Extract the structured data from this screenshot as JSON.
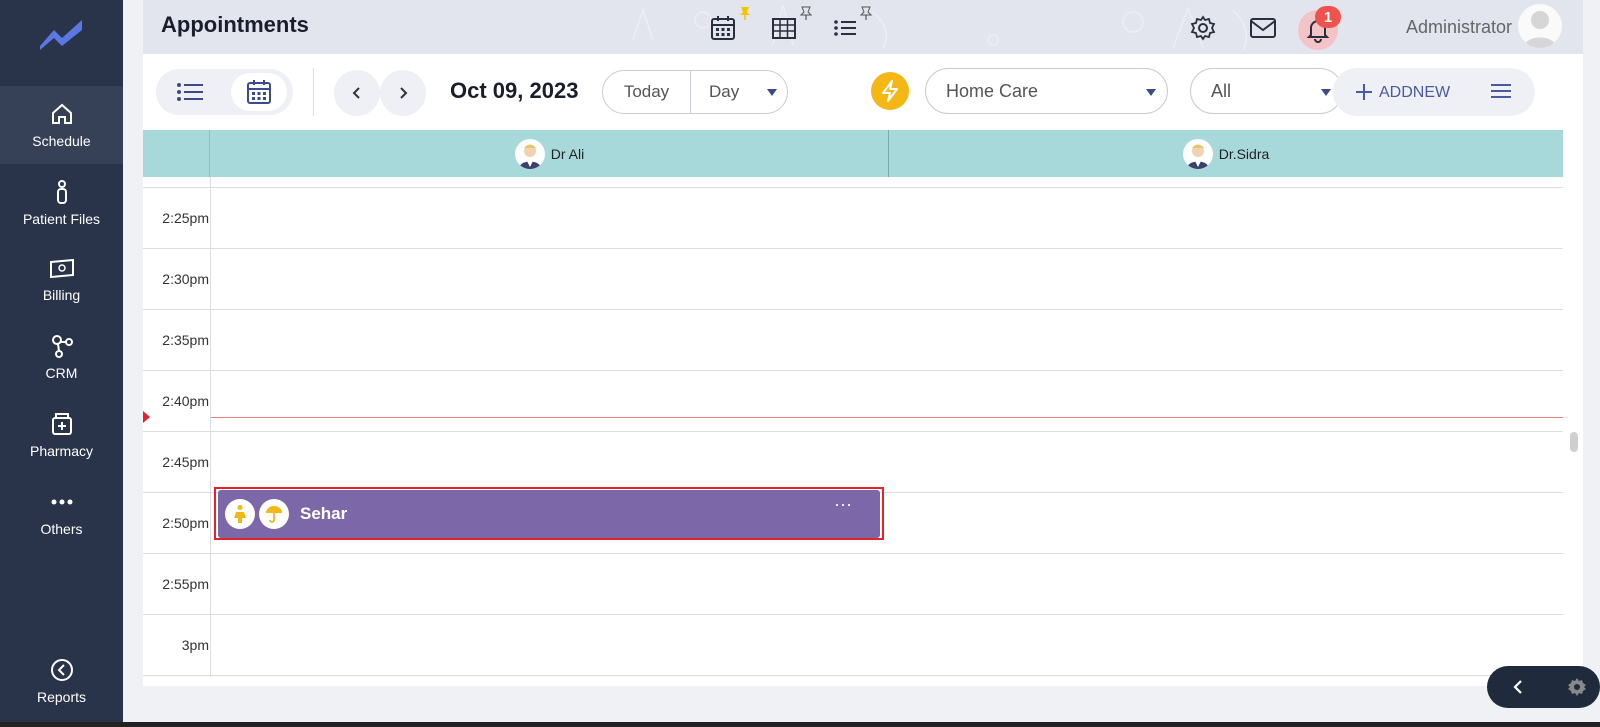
{
  "sidebar": {
    "items": [
      {
        "label": "Schedule",
        "icon": "home-icon"
      },
      {
        "label": "Patient Files",
        "icon": "person-icon"
      },
      {
        "label": "Billing",
        "icon": "cash-icon"
      },
      {
        "label": "CRM",
        "icon": "crm-network-icon"
      },
      {
        "label": "Pharmacy",
        "icon": "medicine-icon"
      },
      {
        "label": "Others",
        "icon": "dots-icon"
      },
      {
        "label": "Reports",
        "icon": "reports-icon"
      }
    ]
  },
  "header": {
    "title": "Appointments",
    "user_name": "Administrator",
    "notification_count": "1"
  },
  "toolbar": {
    "date": "Oct 09, 2023",
    "today_label": "Today",
    "view_select": "Day",
    "department_select": "Home Care",
    "filter_select": "All",
    "addnew_label": "ADDNEW"
  },
  "calendar": {
    "resources": [
      "Dr Ali",
      "Dr.Sidra"
    ],
    "time_slots": [
      "2:25pm",
      "2:30pm",
      "2:35pm",
      "2:40pm",
      "2:45pm",
      "2:50pm",
      "2:55pm",
      "3pm"
    ],
    "appointment": {
      "patient": "Sehar",
      "more": "···",
      "resource": "Dr Ali",
      "time": "2:50pm"
    }
  },
  "colors": {
    "sidebar_bg": "#29344a",
    "resource_header": "#a8d9da",
    "appointment": "#7c68a8",
    "accent": "#f5b716",
    "highlight": "#e8202a"
  }
}
